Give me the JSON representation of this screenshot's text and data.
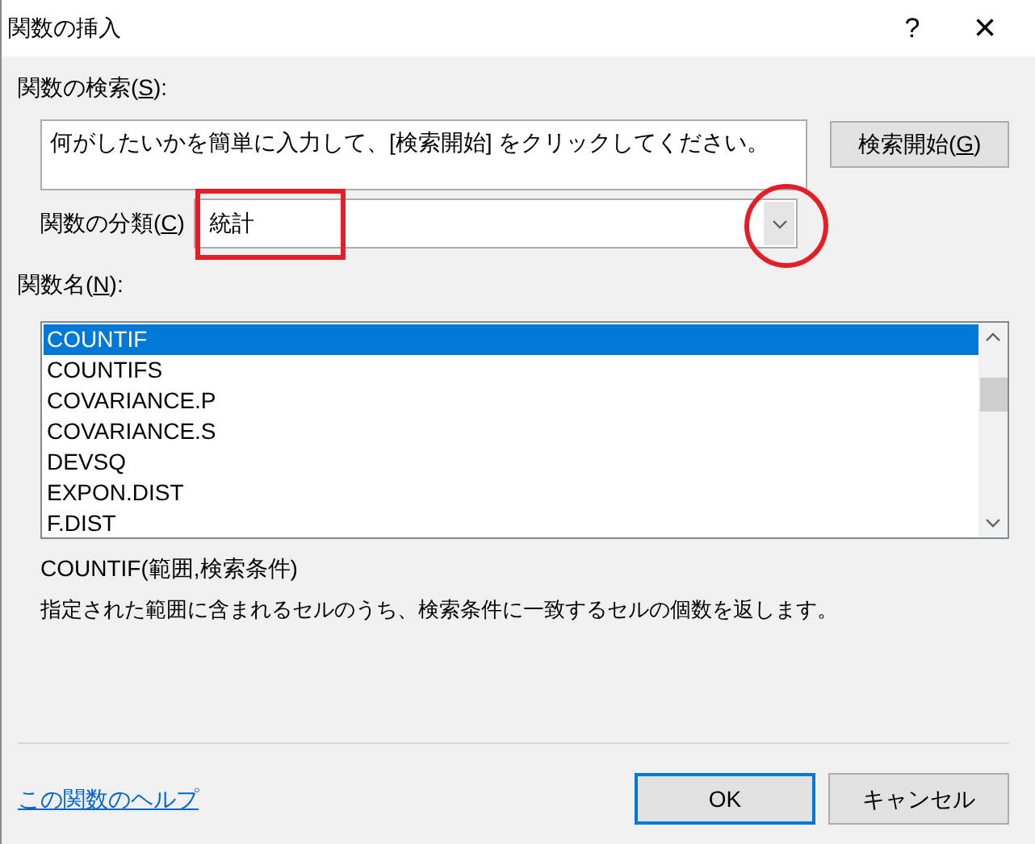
{
  "window": {
    "title": "関数の挿入",
    "help_button": "?",
    "close_button": "×"
  },
  "search": {
    "label": {
      "before": "関数の検索(",
      "key": "S",
      "after": "):"
    },
    "value": "何がしたいかを簡単に入力して、[検索開始] をクリックしてください。",
    "button": {
      "before": "検索開始(",
      "key": "G",
      "after": ")"
    }
  },
  "category": {
    "label": {
      "before": "関数の分類(",
      "key": "C",
      "after": ")"
    },
    "value": "統計"
  },
  "function_list": {
    "label": {
      "before": "関数名(",
      "key": "N",
      "after": "):"
    },
    "items": [
      {
        "name": "COUNTIF",
        "selected": true
      },
      {
        "name": "COUNTIFS",
        "selected": false
      },
      {
        "name": "COVARIANCE.P",
        "selected": false
      },
      {
        "name": "COVARIANCE.S",
        "selected": false
      },
      {
        "name": "DEVSQ",
        "selected": false
      },
      {
        "name": "EXPON.DIST",
        "selected": false
      },
      {
        "name": "F.DIST",
        "selected": false
      }
    ]
  },
  "syntax": "COUNTIF(範囲,検索条件)",
  "description": "指定された範囲に含まれるセルのうち、検索条件に一致するセルの個数を返します。",
  "help_link": "この関数のヘルプ",
  "buttons": [
    {
      "label": "OK",
      "default": true
    },
    {
      "label": "キャンセル",
      "default": false
    }
  ],
  "annotations": [
    {
      "kind": "rectangle"
    },
    {
      "kind": "circle"
    }
  ]
}
